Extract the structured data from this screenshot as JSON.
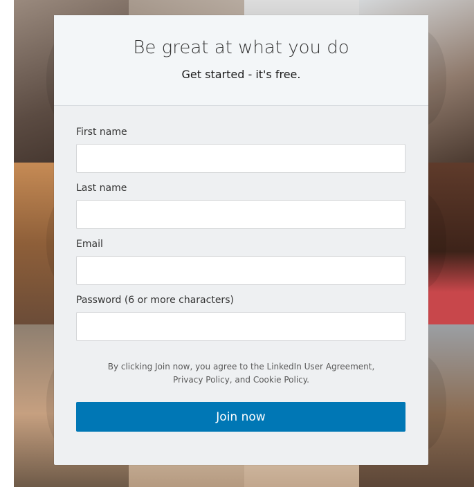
{
  "header": {
    "headline": "Be great at what you do",
    "subhead": "Get started - it's free."
  },
  "form": {
    "fields": [
      {
        "label": "First name",
        "value": ""
      },
      {
        "label": "Last name",
        "value": ""
      },
      {
        "label": "Email",
        "value": ""
      },
      {
        "label": "Password (6 or more characters)",
        "value": ""
      }
    ],
    "legal_line1": "By clicking Join now, you agree to the LinkedIn User Agreement,",
    "legal_line2": "Privacy Policy, and Cookie Policy.",
    "submit_label": "Join now"
  },
  "colors": {
    "accent": "#0077b5",
    "card_bg": "#eef0f2",
    "header_bg": "#f3f6f8"
  }
}
